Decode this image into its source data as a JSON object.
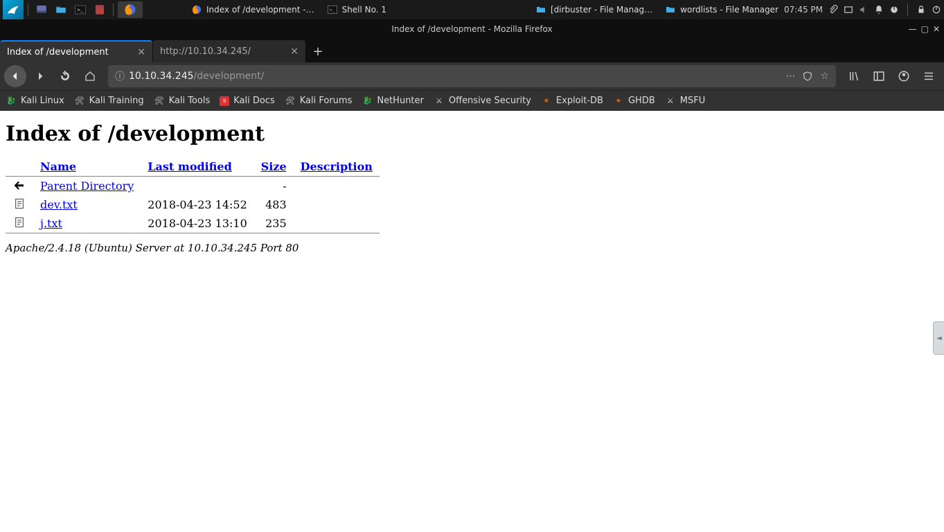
{
  "panel": {
    "tasks": [
      {
        "label": "Index of /development -…",
        "icon": "firefox"
      },
      {
        "label": "Shell No. 1",
        "icon": "terminal"
      },
      {
        "label": "[dirbuster - File Manag…",
        "icon": "folder"
      },
      {
        "label": "wordlists - File Manager",
        "icon": "folder"
      }
    ],
    "clock": "07:45 PM"
  },
  "window": {
    "title": "Index of /development - Mozilla Firefox"
  },
  "tabs": [
    {
      "label": "Index of /development",
      "active": true
    },
    {
      "label": "http://10.10.34.245/",
      "active": false
    }
  ],
  "url": {
    "host": "10.10.34.245",
    "path": "/development/"
  },
  "bookmarks": [
    "Kali Linux",
    "Kali Training",
    "Kali Tools",
    "Kali Docs",
    "Kali Forums",
    "NetHunter",
    "Offensive Security",
    "Exploit-DB",
    "GHDB",
    "MSFU"
  ],
  "page": {
    "heading": "Index of /development",
    "columns": {
      "name": "Name",
      "modified": "Last modified",
      "size": "Size",
      "desc": "Description"
    },
    "rows": [
      {
        "name": "Parent Directory",
        "modified": "",
        "size": "-",
        "icon": "back"
      },
      {
        "name": "dev.txt",
        "modified": "2018-04-23 14:52",
        "size": "483",
        "icon": "text"
      },
      {
        "name": "j.txt",
        "modified": "2018-04-23 13:10",
        "size": "235",
        "icon": "text"
      }
    ],
    "footer": "Apache/2.4.18 (Ubuntu) Server at 10.10.34.245 Port 80"
  }
}
